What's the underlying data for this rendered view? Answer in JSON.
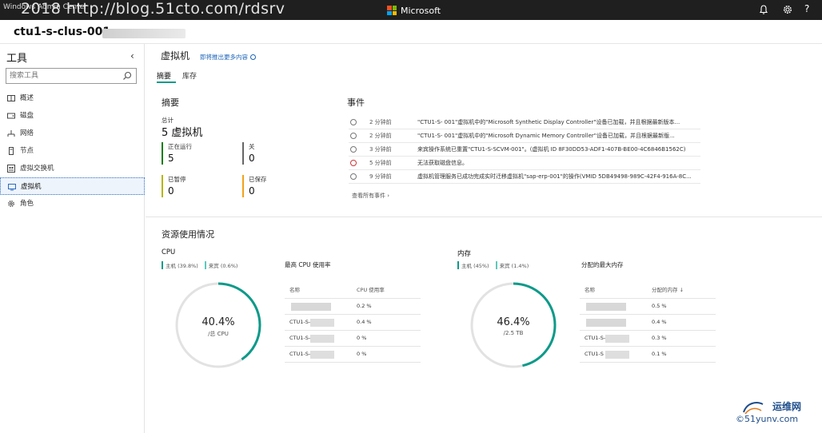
{
  "topbar": {
    "app_title": "Windows Admin Center",
    "watermark": "2018 http://blog.51cto.com/rdsrv",
    "brand": "Microsoft",
    "help": "?"
  },
  "server": {
    "name": "ctu1-s-clus-001."
  },
  "sidebar": {
    "title": "工具",
    "search_placeholder": "搜索工具",
    "items": [
      {
        "label": "概述",
        "icon": "overview-icon"
      },
      {
        "label": "磁盘",
        "icon": "disk-icon"
      },
      {
        "label": "网络",
        "icon": "network-icon"
      },
      {
        "label": "节点",
        "icon": "node-icon"
      },
      {
        "label": "虚拟交换机",
        "icon": "virtual-switch-icon"
      },
      {
        "label": "虚拟机",
        "icon": "virtual-machine-icon"
      },
      {
        "label": "角色",
        "icon": "roles-icon"
      }
    ]
  },
  "main": {
    "title": "虚拟机",
    "link": "即将推出更多内容",
    "tabs": [
      "摘要",
      "库存"
    ],
    "summary": {
      "title": "摘要",
      "total_label": "总计",
      "total_value": "5 虚拟机",
      "running_label": "正在运行",
      "running_value": "5",
      "off_label": "关",
      "off_value": "0",
      "paused_label": "已暂停",
      "paused_value": "0",
      "saved_label": "已保存",
      "saved_value": "0"
    },
    "events": {
      "title": "事件",
      "items": [
        {
          "time": "2 分钟前",
          "message": "\"CTU1-S-          001\"虚拟机中的\"Microsoft Synthetic Display Controller\"设备已加载，并且根据最新版本...",
          "level": "info"
        },
        {
          "time": "2 分钟前",
          "message": "\"CTU1-S-          001\"虚拟机中的\"Microsoft Dynamic Memory Controller\"设备已加载，并且根据最新版...",
          "level": "info"
        },
        {
          "time": "3 分钟前",
          "message": "来宾操作系统已重置\"CTU1-S-SCVM-001\"。(虚拟机 ID 8F30DD53-ADF1-407B-BE00-4C6846B1562C)",
          "level": "info"
        },
        {
          "time": "5 分钟前",
          "message": "无法获取磁盘信息。",
          "level": "error"
        },
        {
          "time": "9 分钟前",
          "message": "虚拟机管理服务已成功完成实时迁移虚拟机\"sap-erp-001\"的操作(VMID 5DB49498-989C-42F4-916A-8C...",
          "level": "info"
        }
      ],
      "see_all": "查看所有事件 ›"
    },
    "resources": {
      "title": "资源使用情况",
      "cpu": {
        "title": "CPU",
        "legend_host": "主机 (39.8%)",
        "legend_guest": "来宾 (0.6%)",
        "usage_fraction": 0.404,
        "donut_pct": "40.4%",
        "donut_sub": "/总 CPU",
        "table_title": "最高 CPU 使用率",
        "col_name": "名称",
        "col_value": "CPU 使用率",
        "rows": [
          {
            "name": "",
            "value": "0.2 %"
          },
          {
            "name": "CTU1-S-          001",
            "value": "0.4 %"
          },
          {
            "name": "CTU1-S-          001",
            "value": "0 %"
          },
          {
            "name": "CTU1-S-          -001",
            "value": "0 %"
          }
        ]
      },
      "memory": {
        "title": "内存",
        "legend_host": "主机 (45%)",
        "legend_guest": "来宾 (1.4%)",
        "usage_fraction": 0.464,
        "donut_pct": "46.4%",
        "donut_sub": "/2.5 TB",
        "table_title": "分配的最大内存",
        "col_name": "名称",
        "col_value": "分配的内存 ↓",
        "rows": [
          {
            "name": "",
            "value": "0.5 %"
          },
          {
            "name": "",
            "value": "0.4 %"
          },
          {
            "name": "CTU1-S-          -001",
            "value": "0.3 %"
          },
          {
            "name": "CTU1-S          C-001",
            "value": "0.1 %"
          }
        ]
      }
    }
  },
  "corner_logo": {
    "line1": "运维网",
    "line2": "©51yunv.com"
  },
  "colors": {
    "accent": "#0d9a8a",
    "link": "#1a62b8",
    "running": "#107c10",
    "off": "#666666",
    "paused": "#b5b500",
    "saved": "#f2a21b",
    "error": "#d13438"
  }
}
